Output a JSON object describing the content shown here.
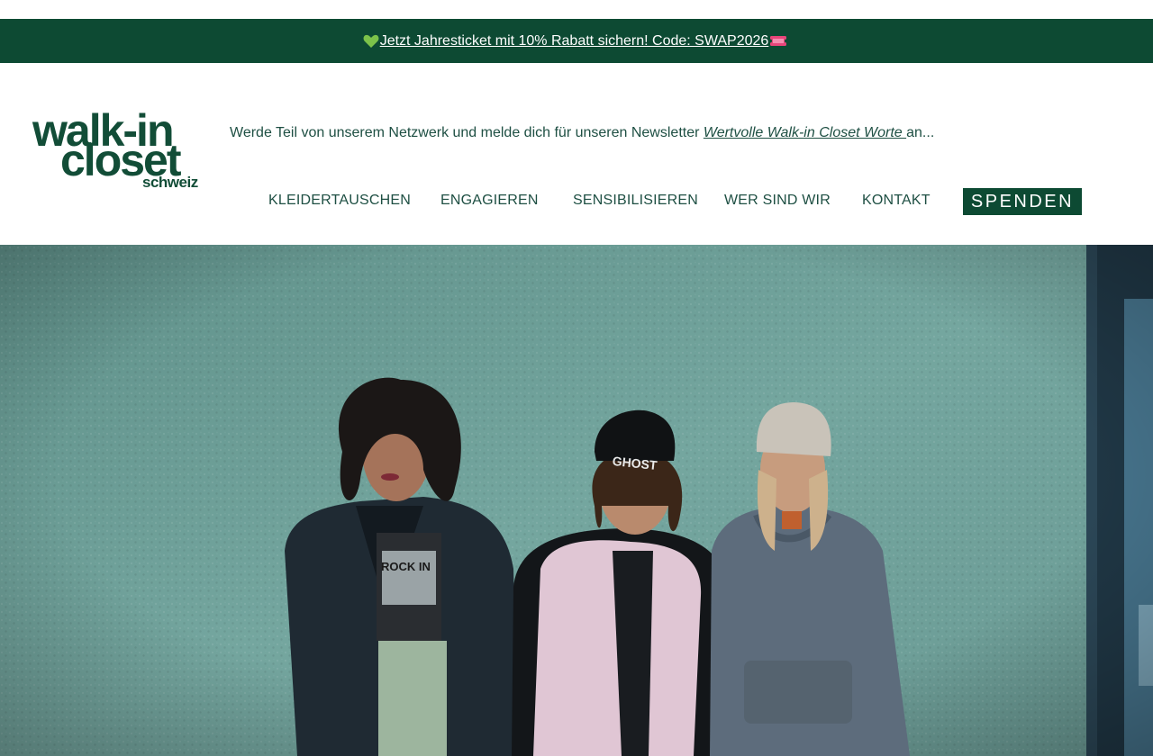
{
  "promo": {
    "text": "Jetzt Jahresticket mit 10% Rabatt sichern! Code: SWAP2026",
    "icons": [
      "green-heart-icon",
      "ticket-icon"
    ],
    "background": "#0d4a33"
  },
  "header": {
    "logo": {
      "line1": "walk-in",
      "line2": "closet",
      "line3": "schweiz",
      "color": "#124d37"
    },
    "newsletter": {
      "prefix": "Werde Teil von unserem Netzwerk und melde dich für unseren Newsletter ",
      "link": "Wertvolle Walk-in Closet Worte ",
      "suffix": "an..."
    },
    "nav": [
      {
        "label": "KLEIDERTAUSCHEN"
      },
      {
        "label": "ENGAGIEREN"
      },
      {
        "label": "SENSIBILISIEREN"
      },
      {
        "label": "WER SIND WIR"
      },
      {
        "label": "KONTAKT"
      }
    ],
    "donate_label": "SPENDEN"
  },
  "hero": {
    "image": "three-people-in-front-of-teal-wall-photo",
    "beanie_text": "GHOST",
    "shirt_text": "ROCK IN"
  },
  "colors": {
    "brand_green": "#0d4a33",
    "text_green": "#1e4f43",
    "wall_teal": "#6d9e98"
  }
}
